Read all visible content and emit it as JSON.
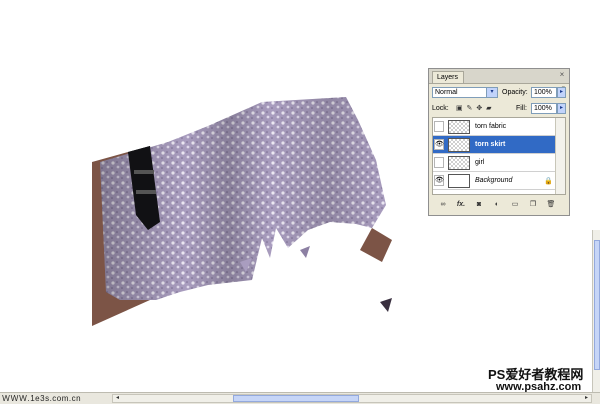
{
  "layers_panel": {
    "tab_label": "Layers",
    "close_glyph": "×",
    "menu_glyph": "▸≡",
    "blend_mode": "Normal",
    "opacity_label": "Opacity:",
    "opacity_value": "100%",
    "lock_label": "Lock:",
    "fill_label": "Fill:",
    "fill_value": "100%",
    "dropdown_glyph": "▾",
    "step_glyph": "▸",
    "layers": [
      {
        "name": "torn fabric",
        "visible": false
      },
      {
        "name": "torn skirt",
        "visible": true,
        "selected": true
      },
      {
        "name": "girl",
        "visible": false
      },
      {
        "name": "Background",
        "visible": true,
        "locked": true
      }
    ],
    "eye_glyph": "👁",
    "lock_glyph": "🔒",
    "bottom_icons": [
      "link-icon",
      "fx-icon",
      "mask-icon",
      "adjustment-icon",
      "folder-icon",
      "new-layer-icon",
      "trash-icon"
    ]
  },
  "watermark": {
    "title": "PS爱好者教程网",
    "url": "www.psahz.com"
  },
  "status_bar": {
    "left_text": "ＷＷＷ.1e3s.com.cn"
  },
  "colors": {
    "selection": "#316ac5",
    "fabric": "#a79bbd",
    "skin": "#7c5446"
  }
}
